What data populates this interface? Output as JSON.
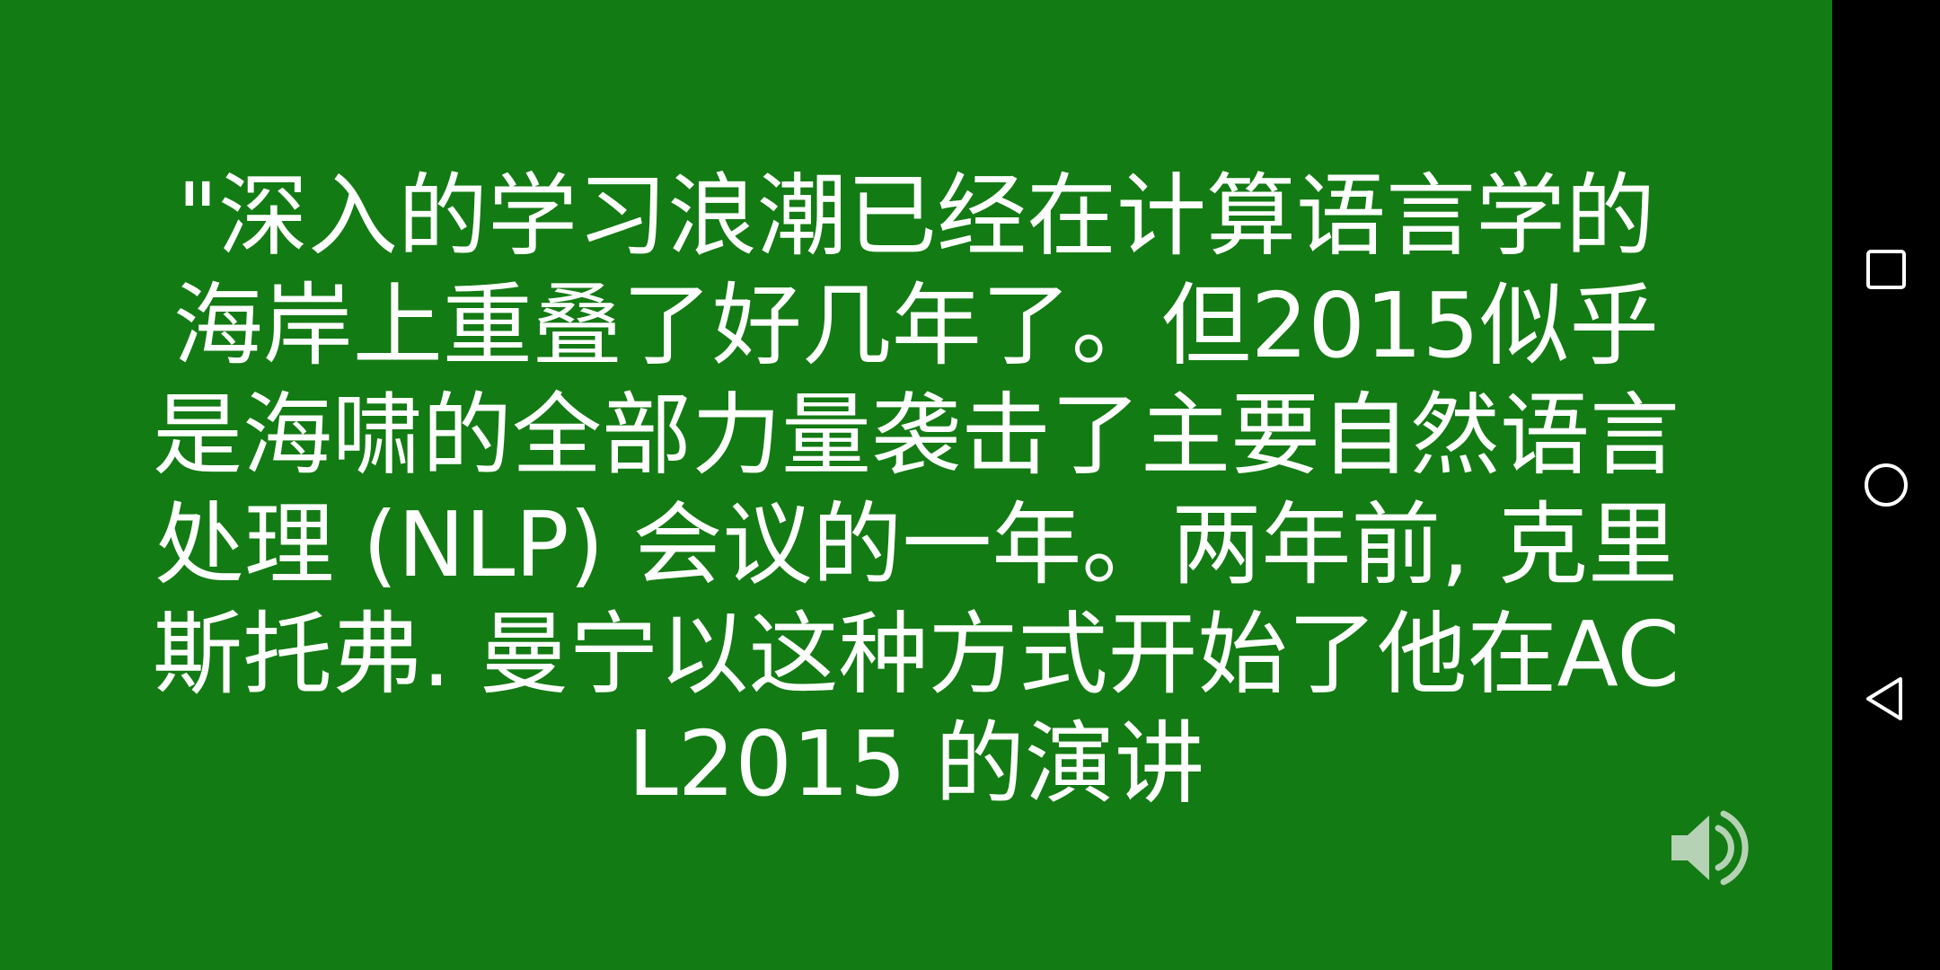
{
  "quote": {
    "text": "\"深入的学习浪潮已经在计算语言学的海岸上重叠了好几年了。但2015似乎是海啸的全部力量袭击了主要自然语言处理 (NLP) 会议的一年。两年前, 克里斯托弗. 曼宁以这种方式开始了他在ACL2015 的演讲"
  },
  "colors": {
    "background": "#137b13",
    "text": "#ffffff",
    "speaker_icon": "#c8dcc8",
    "navbar": "#000000",
    "nav_icon": "#ffffff"
  },
  "icons": {
    "speaker": "speaker-volume-icon",
    "recents": "square-recents-icon",
    "home": "circle-home-icon",
    "back": "triangle-back-icon"
  }
}
